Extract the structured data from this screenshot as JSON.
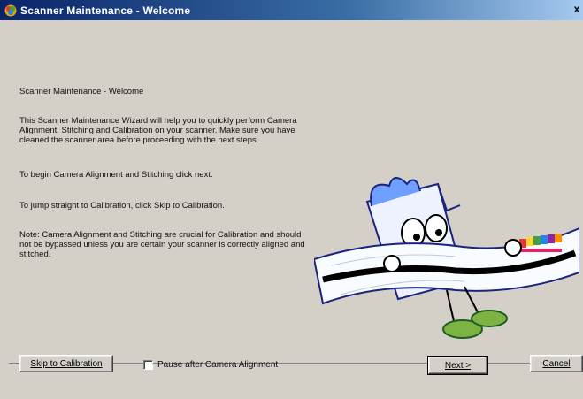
{
  "window": {
    "title": "Scanner Maintenance - Welcome",
    "close_label": "x"
  },
  "content": {
    "heading": "Scanner Maintenance - Welcome",
    "paragraph_intro": "This Scanner Maintenance Wizard will help you to quickly perform Camera Alignment, Stitching and Calibration on your scanner. Make sure you have cleaned the scanner area before proceeding with the next steps.",
    "paragraph_next": "To begin Camera Alignment and Stitching click next.",
    "paragraph_skip": "To jump straight to Calibration, click Skip to Calibration.",
    "paragraph_note": "Note: Camera Alignment and Stitching are crucial for Calibration and should not be bypassed unless you are certain your scanner is correctly aligned and stitched."
  },
  "footer": {
    "skip_button": "Skip to Calibration",
    "pause_checkbox_label": "Pause after Camera Alignment",
    "pause_checked": false,
    "next_button": "Next >",
    "cancel_button": "Cancel"
  },
  "icons": {
    "app": "scanner-app-icon",
    "close": "close-icon",
    "mascot": "scanner-mascot-illustration"
  },
  "colors": {
    "window_bg": "#d4d0c8",
    "titlebar_start": "#0a246a",
    "titlebar_end": "#a6caf0"
  }
}
